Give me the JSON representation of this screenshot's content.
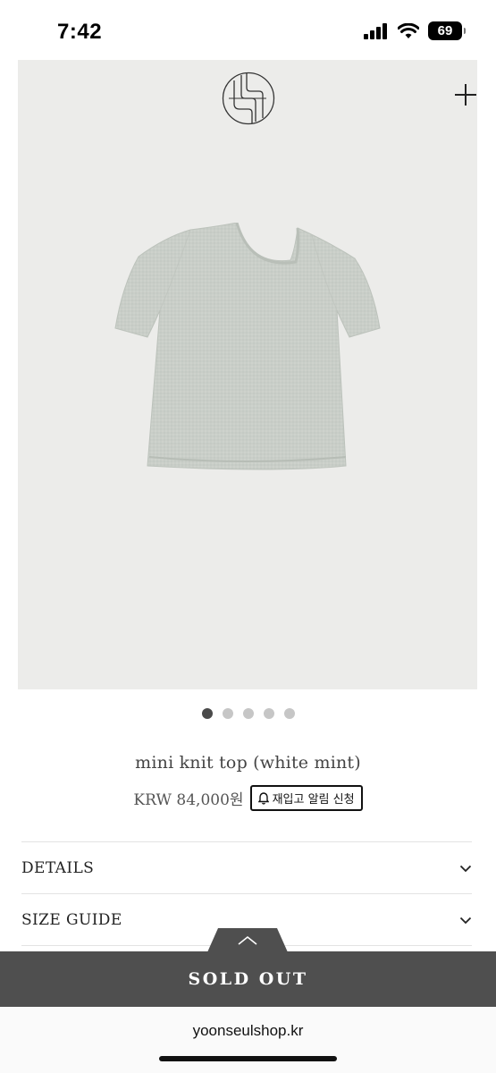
{
  "status_bar": {
    "time": "7:42",
    "battery_level": "69"
  },
  "hero": {
    "logo_icon": "brand-monogram-icon",
    "plus_icon": "plus-icon",
    "image_subject": "knit-top-photo",
    "image_count": 5,
    "active_index": 0
  },
  "product": {
    "title": "mini knit top (white mint)",
    "price": "KRW 84,000원",
    "restock_label": "재입고 알림 신청"
  },
  "accordions": [
    {
      "label": "DETAILS"
    },
    {
      "label": "SIZE GUIDE"
    }
  ],
  "footer": {
    "sold_out_label": "SOLD OUT",
    "url": "yoonseulshop.kr"
  },
  "colors": {
    "hero_bg": "#ececea",
    "sold_out_bar": "#4f4f4f",
    "garment": "#c9cec8"
  }
}
